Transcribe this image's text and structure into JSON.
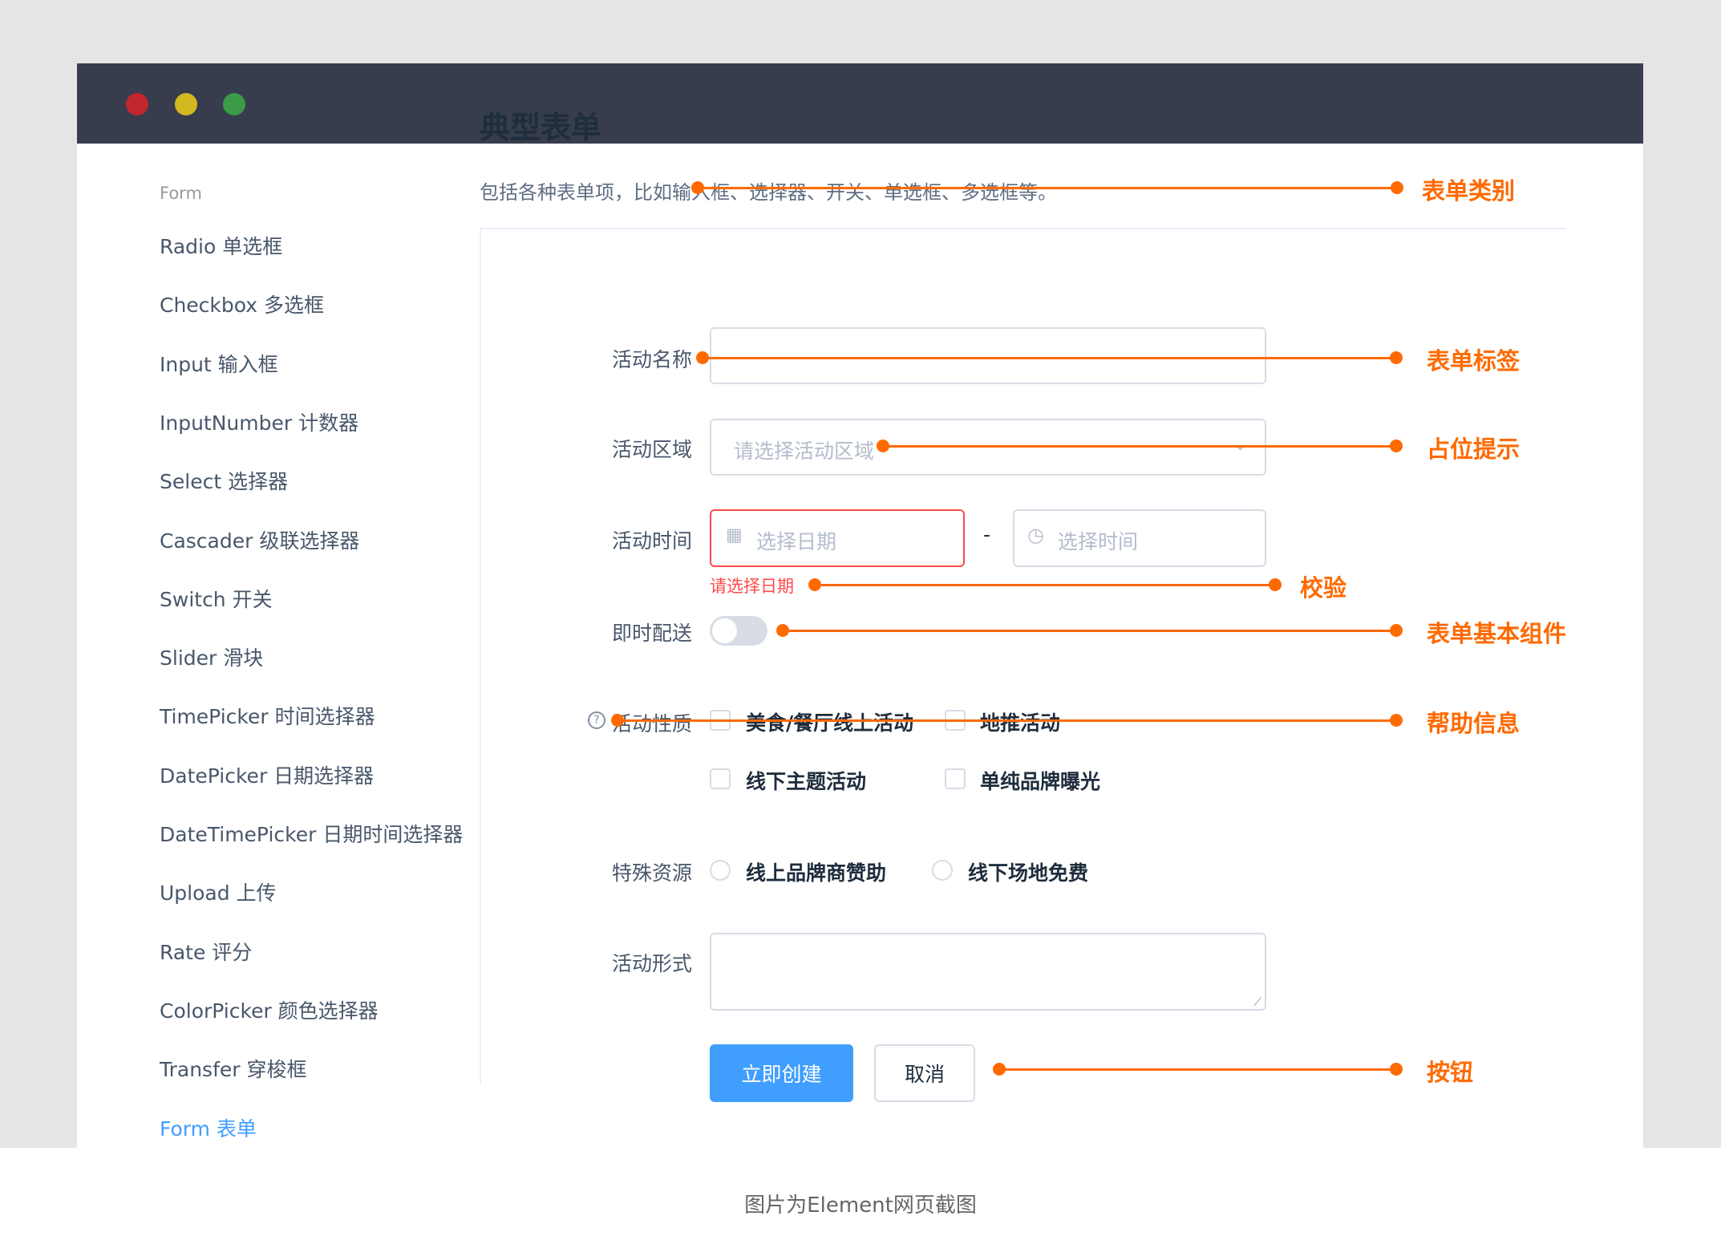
{
  "window": {
    "dots": [
      {
        "name": "close",
        "color": "#c1272d"
      },
      {
        "name": "minimize",
        "color": "#d4b820"
      },
      {
        "name": "maximize",
        "color": "#3a9b48"
      }
    ]
  },
  "sidebar": {
    "heading": "Form",
    "items": [
      {
        "label": "Radio 单选框"
      },
      {
        "label": "Checkbox 多选框"
      },
      {
        "label": "Input 输入框"
      },
      {
        "label": "InputNumber 计数器"
      },
      {
        "label": "Select 选择器"
      },
      {
        "label": "Cascader 级联选择器"
      },
      {
        "label": "Switch 开关"
      },
      {
        "label": "Slider 滑块"
      },
      {
        "label": "TimePicker 时间选择器"
      },
      {
        "label": "DatePicker 日期选择器"
      },
      {
        "label": "DateTimePicker 日期时间选择器"
      },
      {
        "label": "Upload 上传"
      },
      {
        "label": "Rate 评分"
      },
      {
        "label": "ColorPicker 颜色选择器"
      },
      {
        "label": "Transfer 穿梭框"
      },
      {
        "label": "Form 表单",
        "active": true
      }
    ]
  },
  "page": {
    "title": "典型表单",
    "description": "包括各种表单项，比如输入框、选择器、开关、单选框、多选框等。"
  },
  "form": {
    "name": {
      "label": "活动名称",
      "value": ""
    },
    "region": {
      "label": "活动区域",
      "placeholder": "请选择活动区域"
    },
    "time": {
      "label": "活动时间",
      "date_placeholder": "选择日期",
      "separator": "-",
      "time_placeholder": "选择时间",
      "error": "请选择日期"
    },
    "delivery": {
      "label": "即时配送",
      "on": false
    },
    "type": {
      "label": "活动性质",
      "options": [
        {
          "label": "美食/餐厅线上活动",
          "checked": false
        },
        {
          "label": "地推活动",
          "checked": false
        },
        {
          "label": "线下主题活动",
          "checked": false
        },
        {
          "label": "单纯品牌曝光",
          "checked": false
        }
      ]
    },
    "resource": {
      "label": "特殊资源",
      "options": [
        {
          "label": "线上品牌商赞助",
          "selected": false
        },
        {
          "label": "线下场地免费",
          "selected": false
        }
      ]
    },
    "desc": {
      "label": "活动形式",
      "value": ""
    },
    "submit": "立即创建",
    "cancel": "取消"
  },
  "annotations": {
    "accent": "#ff6a00",
    "category": "表单类别",
    "label": "表单标签",
    "placeholder": "占位提示",
    "validation": "校验",
    "component": "表单基本组件",
    "help": "帮助信息",
    "button": "按钮"
  },
  "caption": "图片为Element网页截图"
}
